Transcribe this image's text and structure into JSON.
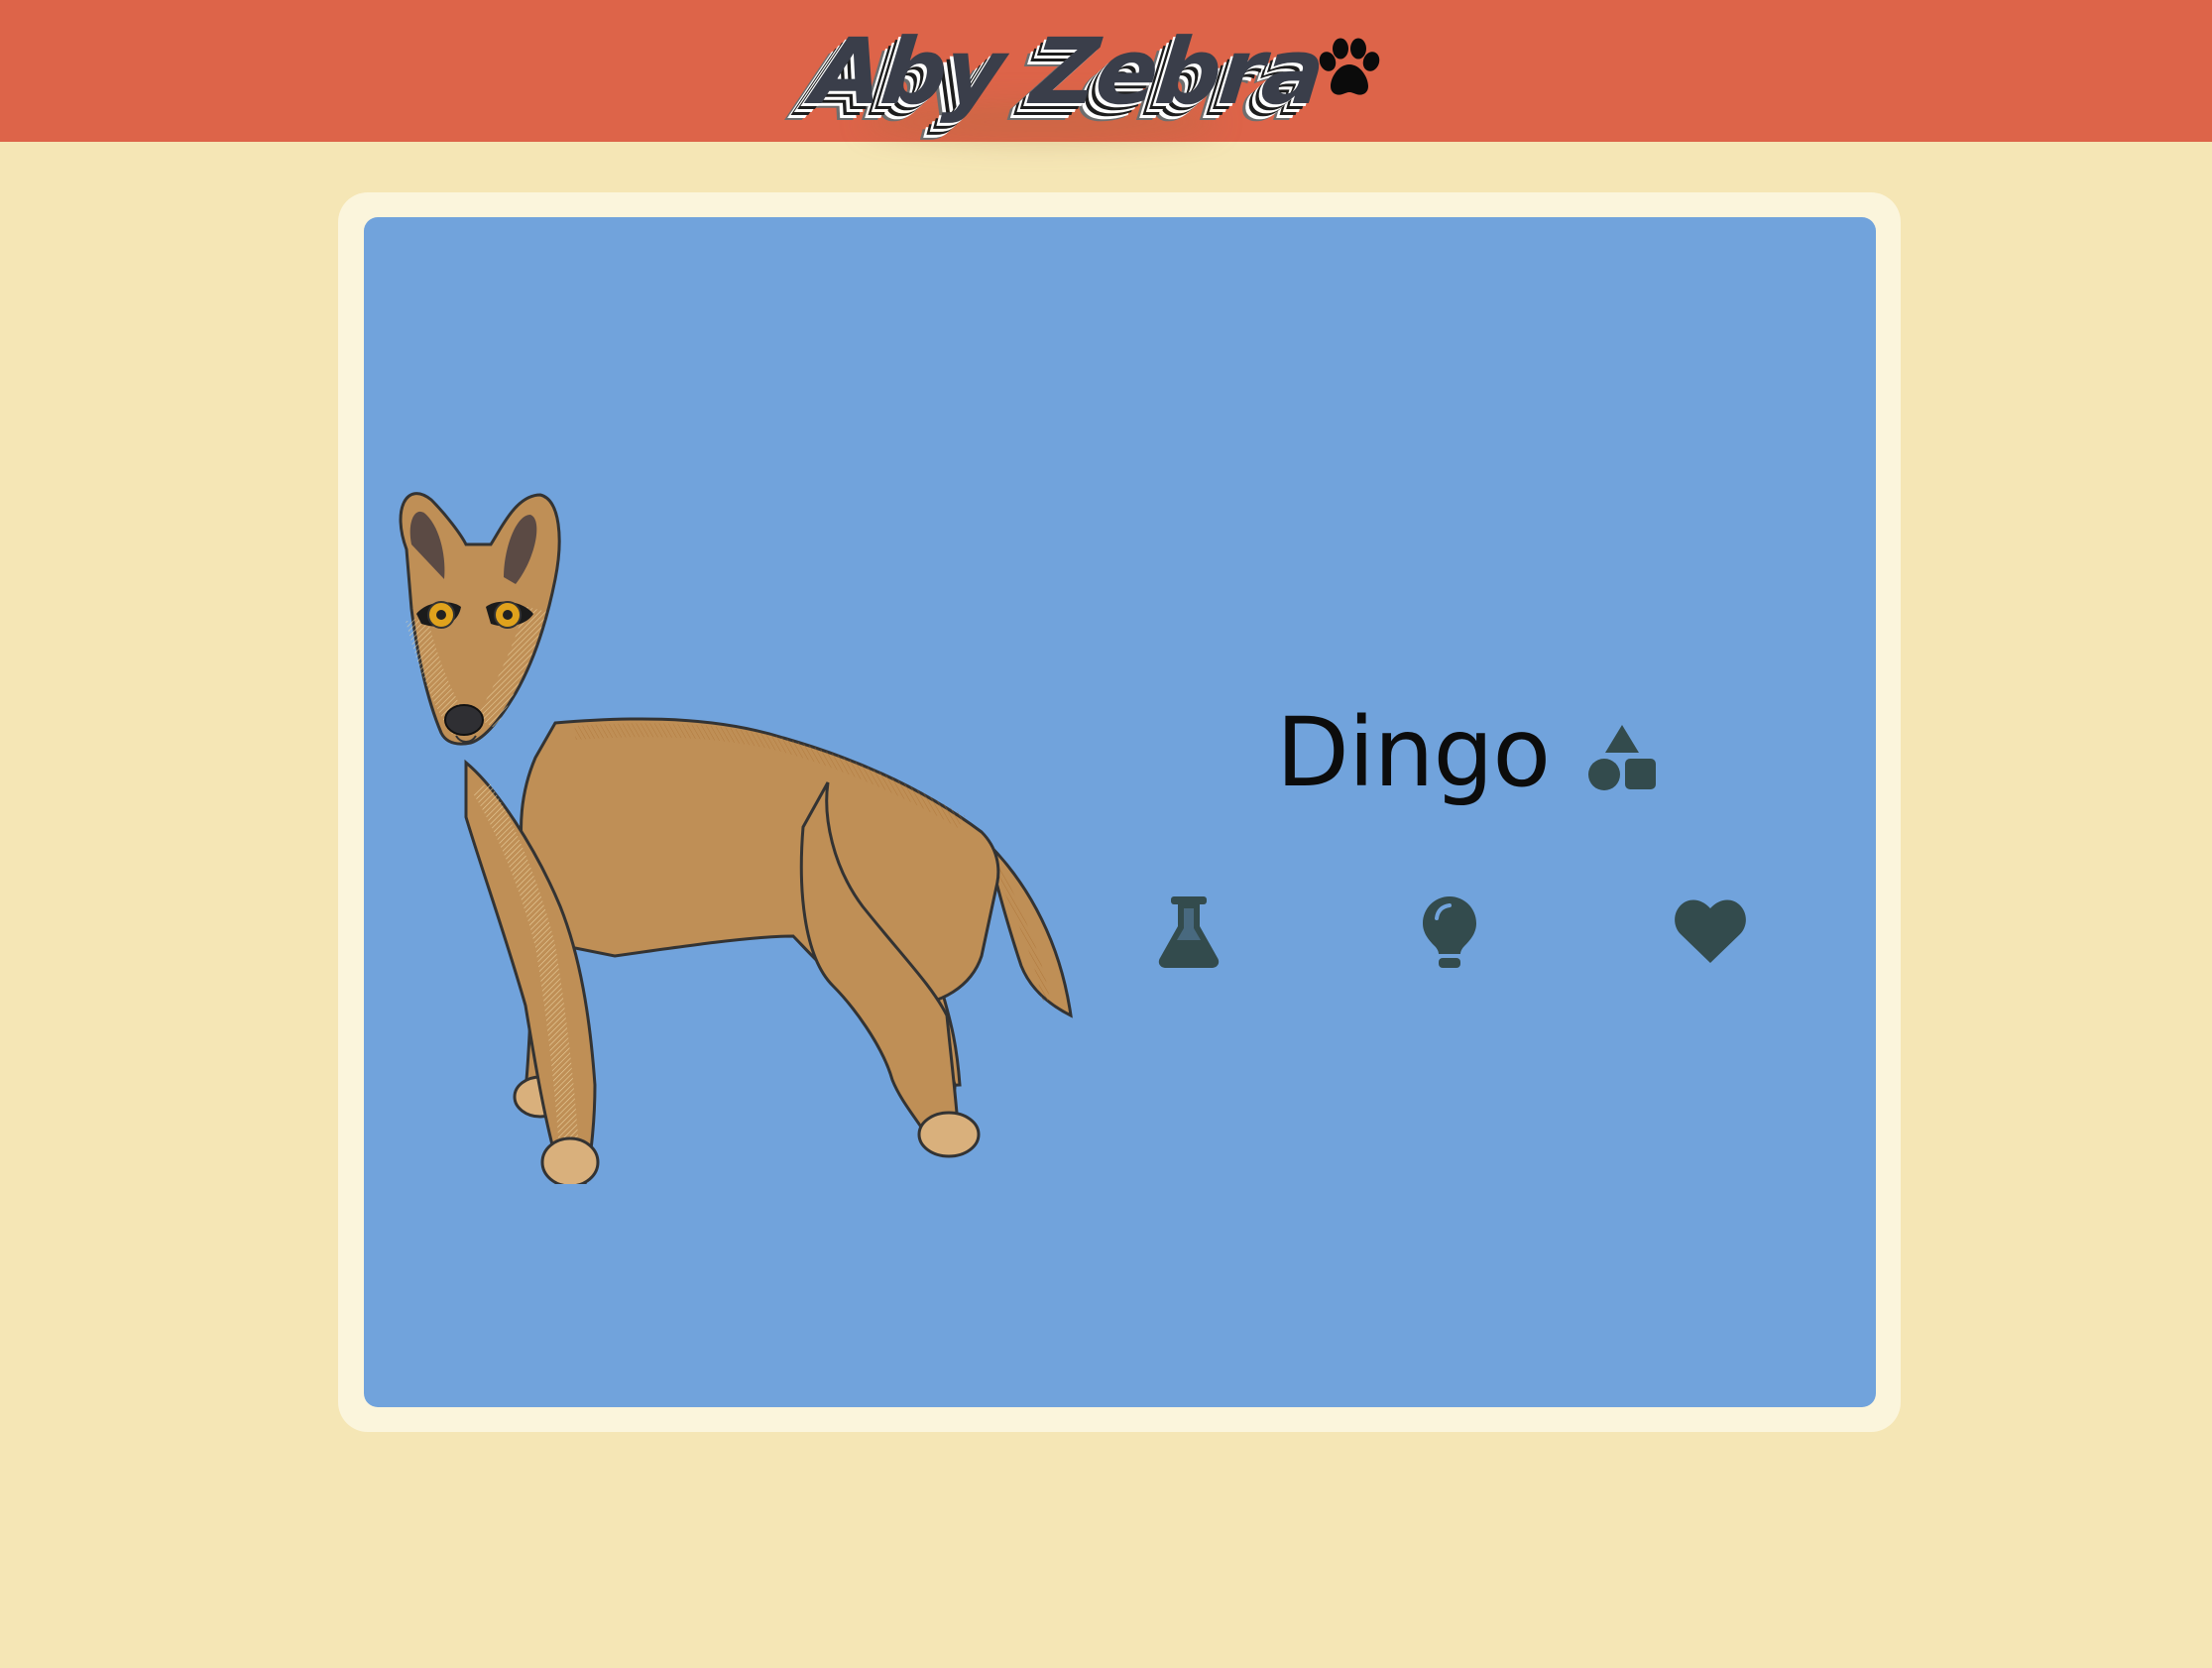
{
  "header": {
    "logo_text": "Aby Zebra",
    "paw_icon": "paw-icon",
    "background_color": "#dd6449"
  },
  "card": {
    "background_color": "#71a3dc",
    "frame_color": "#fbf5dc",
    "illustration": "dingo-illustration",
    "animal_name": "Dingo",
    "name_icon": "shapes-icon",
    "actions": [
      {
        "icon": "flask-icon"
      },
      {
        "icon": "lightbulb-icon"
      },
      {
        "icon": "heart-icon"
      }
    ],
    "icon_color": "#334b4d"
  },
  "page": {
    "background_color": "#f5e6b5"
  }
}
